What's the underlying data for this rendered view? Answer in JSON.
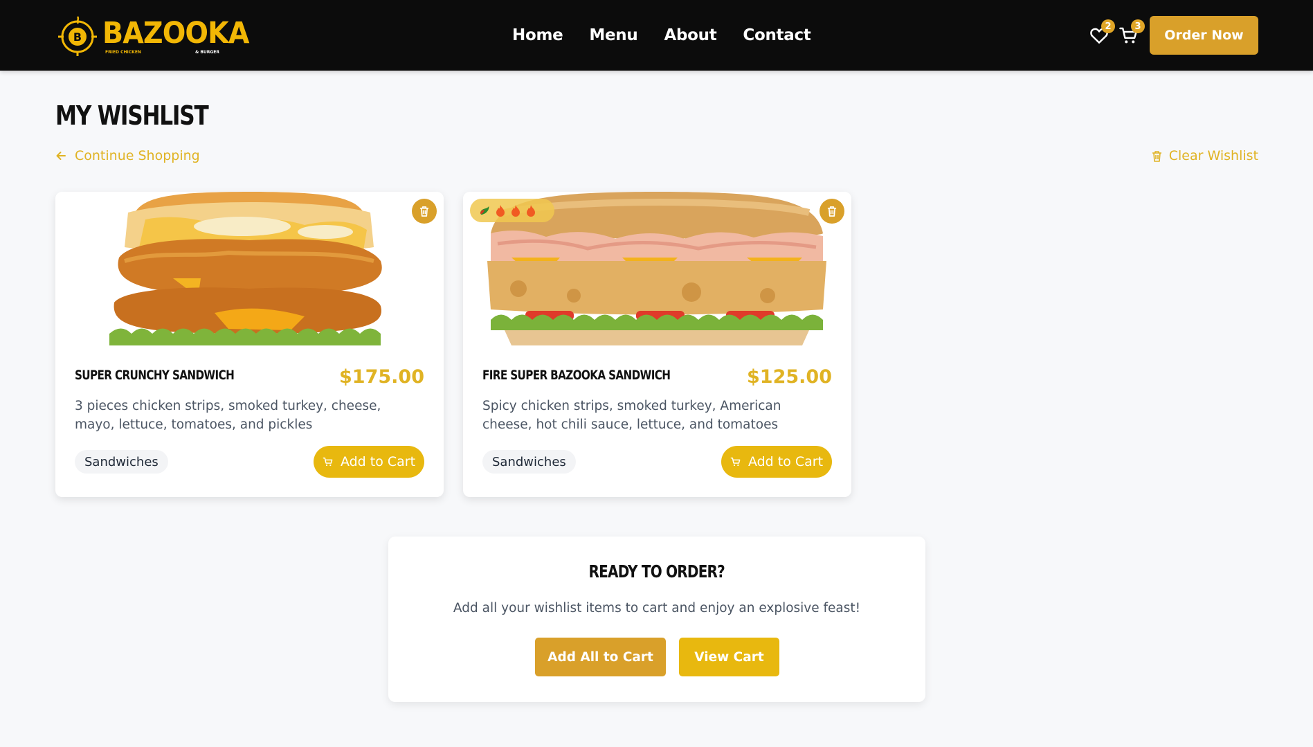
{
  "brand": {
    "name": "BAZOOKA",
    "tagline_left": "FRIED CHICKEN",
    "tagline_right": "& BURGER",
    "accent": "#e0b324",
    "button": "#d9a02a"
  },
  "nav": {
    "items": [
      "Home",
      "Menu",
      "About",
      "Contact"
    ],
    "wishlist_icon": "heart-icon",
    "wishlist_count": "2",
    "cart_icon": "cart-icon",
    "cart_count": "3",
    "order_now": "Order Now"
  },
  "page": {
    "title": "MY WISHLIST",
    "continue_label": "Continue Shopping",
    "clear_label": "Clear Wishlist"
  },
  "items": [
    {
      "name": "SUPER CRUNCHY SANDWICH",
      "price": "$175.00",
      "description": "3 pieces chicken strips, smoked turkey, cheese, mayo, lettuce, tomatoes, and pickles",
      "category": "Sandwiches",
      "add_label": "Add to Cart",
      "spicy": false
    },
    {
      "name": "FIRE SUPER BAZOOKA SANDWICH",
      "price": "$125.00",
      "description": "Spicy chicken strips, smoked turkey, American cheese, hot chili sauce, lettuce, and tomatoes",
      "category": "Sandwiches",
      "add_label": "Add to Cart",
      "spicy": true
    }
  ],
  "order_panel": {
    "title": "READY TO ORDER?",
    "subtitle": "Add all your wishlist items to cart and enjoy an explosive feast!",
    "add_all_label": "Add All to Cart",
    "view_cart_label": "View Cart"
  }
}
